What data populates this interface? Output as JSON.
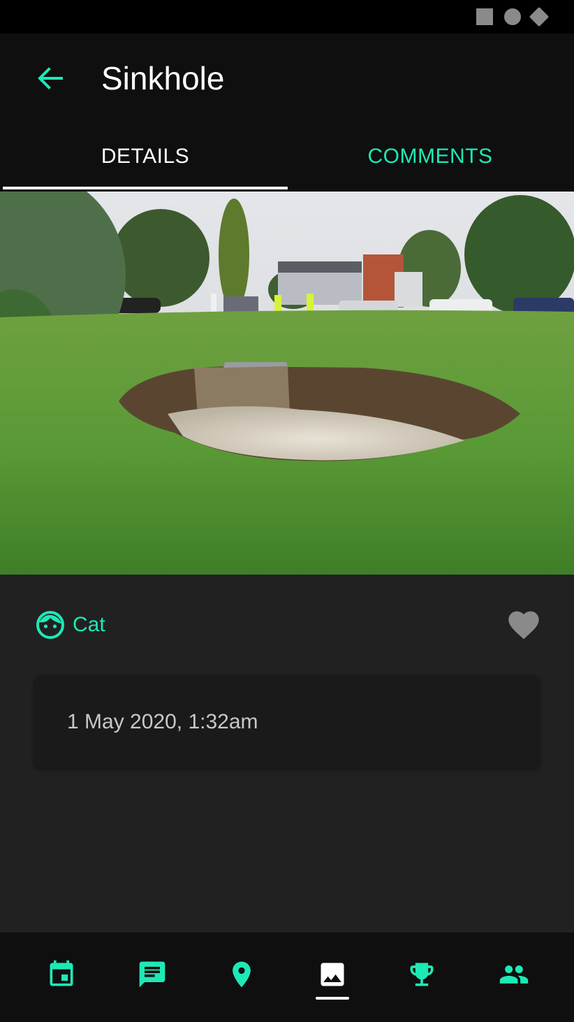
{
  "app": {
    "accent_color": "#1de9b6",
    "title": "Sinkhole"
  },
  "tabs": [
    {
      "label": "DETAILS",
      "active": true
    },
    {
      "label": "COMMENTS",
      "active": false
    }
  ],
  "post": {
    "author": "Cat",
    "author_icon": "face-icon",
    "like_icon": "heart-icon",
    "liked": false,
    "date": "1 May 2020, 1:32am"
  },
  "bottom_nav": [
    {
      "icon": "calendar-icon",
      "active": false
    },
    {
      "icon": "chat-icon",
      "active": false
    },
    {
      "icon": "location-pin-icon",
      "active": false
    },
    {
      "icon": "image-icon",
      "active": true
    },
    {
      "icon": "trophy-icon",
      "active": false
    },
    {
      "icon": "group-icon",
      "active": false
    }
  ]
}
